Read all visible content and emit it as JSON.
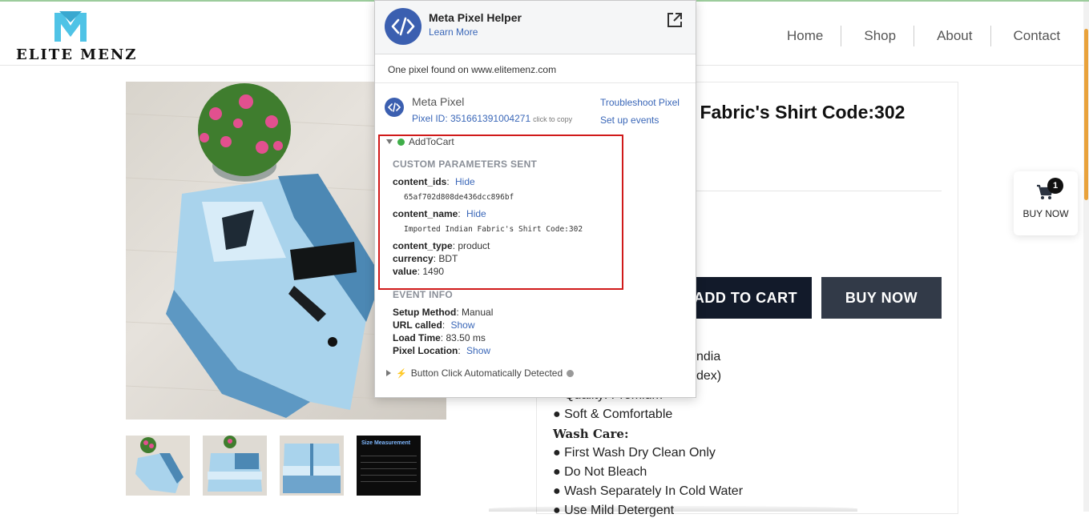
{
  "brand": {
    "name": "ELITE MENZ"
  },
  "nav": {
    "items": [
      "Home",
      "Shop",
      "About",
      "Contact"
    ]
  },
  "product": {
    "title_partial": "n Fabric's Shirt Code:302",
    "add_to_cart": "ADD TO CART",
    "buy_now": "BUY NOW",
    "detail_lines": [
      {
        "text": "ndia",
        "partial": true
      },
      {
        "text": "dex)",
        "partial": true
      },
      {
        "text": "● Quality: Premium",
        "partial": true
      },
      {
        "text": "● Soft & Comfortable"
      },
      {
        "text": "Wash Care:"
      },
      {
        "text": "● First Wash Dry Clean Only"
      },
      {
        "text": "● Do Not Bleach"
      },
      {
        "text": "● Wash Separately In Cold Water"
      },
      {
        "text": "● Use Mild Detergent",
        "partial": true
      }
    ]
  },
  "size_thumb": {
    "title": "Size Measurement"
  },
  "floating_cart": {
    "count": "1",
    "label": "BUY NOW"
  },
  "pixel_helper": {
    "title": "Meta Pixel Helper",
    "learn_more": "Learn More",
    "found_text": "One pixel found on www.elitemenz.com",
    "pixel_name": "Meta Pixel",
    "pixel_id_label": "Pixel ID: 351661391004271",
    "click_to_copy": "click to copy",
    "troubleshoot": "Troubleshoot Pixel",
    "setup_events": "Set up events",
    "event_name": "AddToCart",
    "custom_params_header": "CUSTOM PARAMETERS SENT",
    "content_ids_key": "content_ids",
    "content_ids_value": "65af702d808de436dcc896bf",
    "content_name_key": "content_name",
    "content_name_value": "Imported Indian Fabric's Shirt Code:302",
    "hide_label": "Hide",
    "content_type_key": "content_type",
    "content_type_value": "product",
    "currency_key": "currency",
    "currency_value": "BDT",
    "value_key": "value",
    "value_value": "1490",
    "event_info_header": "EVENT INFO",
    "setup_method_key": "Setup Method",
    "setup_method_value": "Manual",
    "url_called_key": "URL called",
    "show_label": "Show",
    "load_time_key": "Load Time",
    "load_time_value": "83.50 ms",
    "pixel_location_key": "Pixel Location",
    "button_click_event": "Button Click Automatically Detected"
  }
}
